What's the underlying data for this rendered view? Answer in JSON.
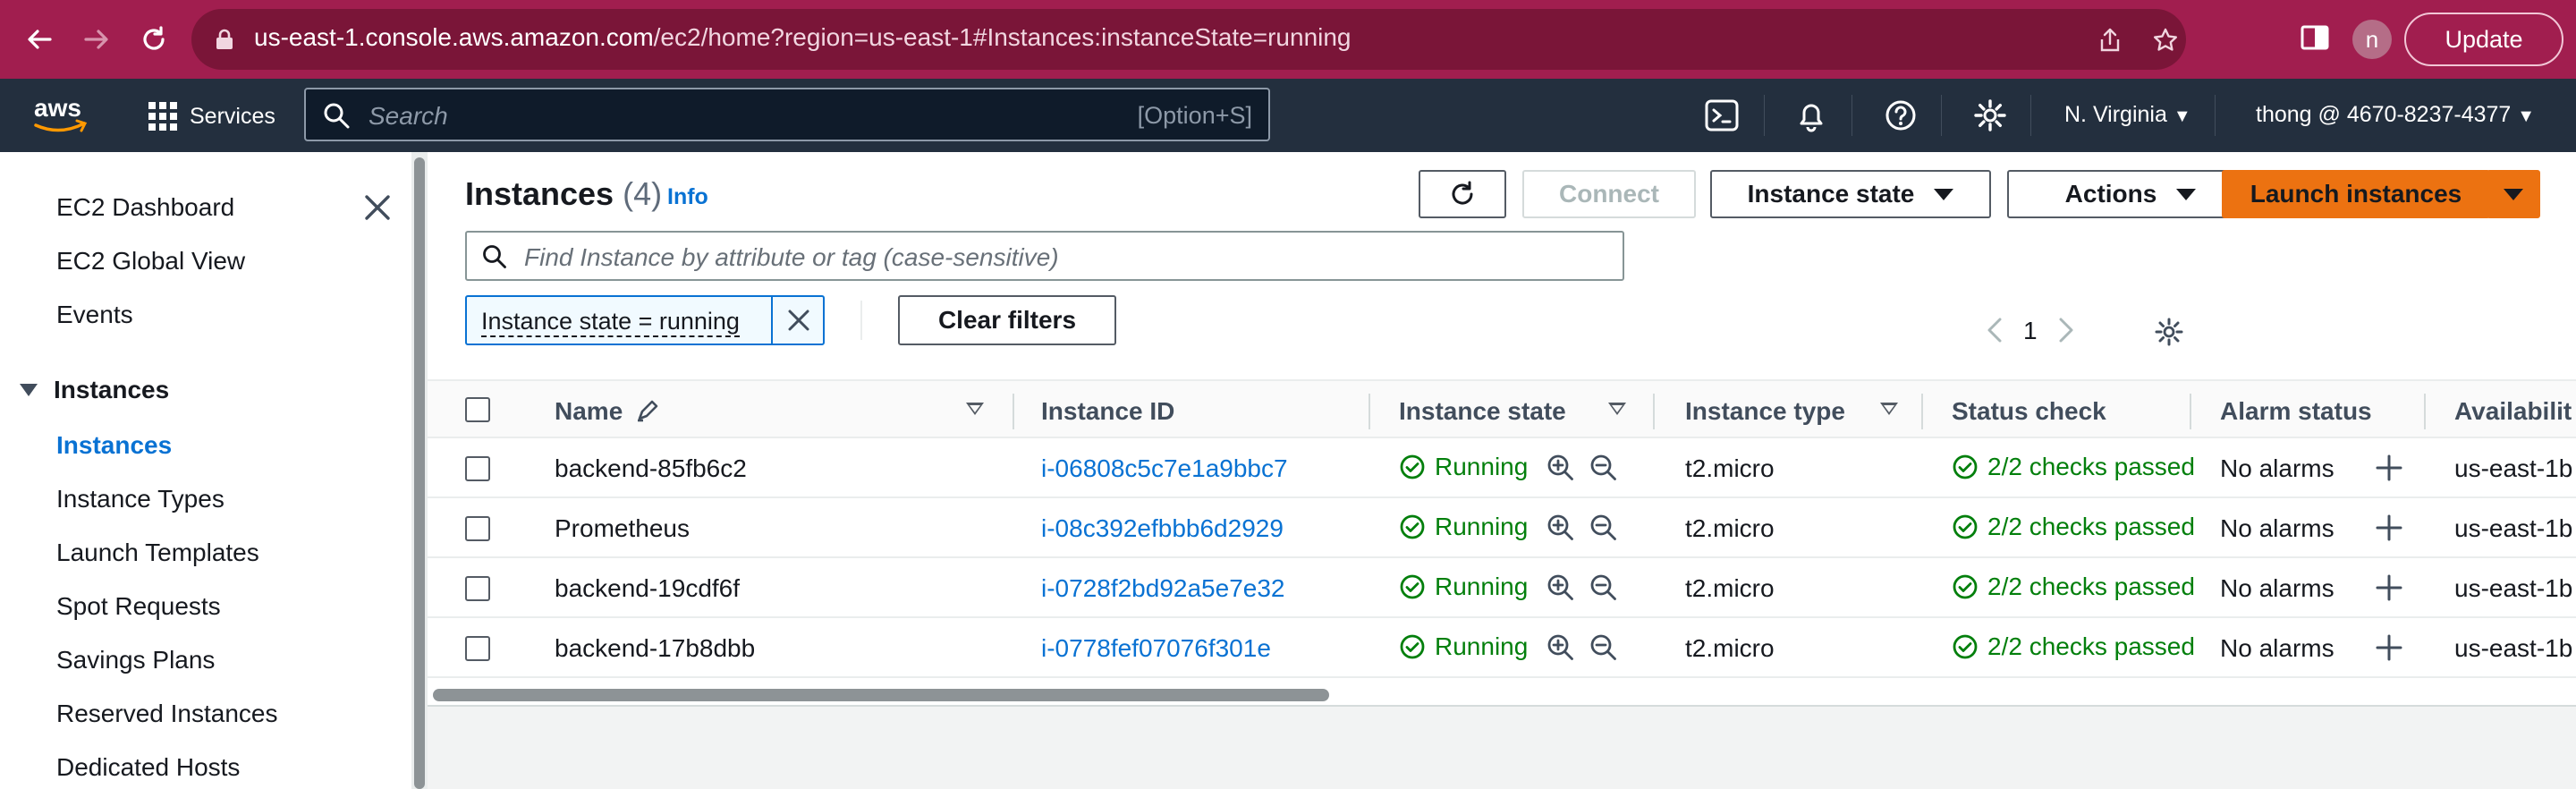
{
  "browser": {
    "url_host": "us-east-1.console.aws.amazon.com",
    "url_path": "/ec2/home?region=us-east-1#Instances:instanceState=running",
    "profile_initial": "n",
    "update_label": "Update"
  },
  "topnav": {
    "services_label": "Services",
    "search_placeholder": "Search",
    "search_shortcut": "[Option+S]",
    "region": "N. Virginia",
    "account": "thong @ 4670-8237-4377"
  },
  "sidebar": {
    "items": [
      {
        "label": "EC2 Dashboard"
      },
      {
        "label": "EC2 Global View"
      },
      {
        "label": "Events"
      }
    ],
    "group_label": "Instances",
    "group_items": [
      {
        "label": "Instances",
        "active": true
      },
      {
        "label": "Instance Types"
      },
      {
        "label": "Launch Templates"
      },
      {
        "label": "Spot Requests"
      },
      {
        "label": "Savings Plans"
      },
      {
        "label": "Reserved Instances"
      },
      {
        "label": "Dedicated Hosts"
      }
    ]
  },
  "header": {
    "title": "Instances",
    "count": "(4)",
    "info_label": "Info",
    "connect_label": "Connect",
    "instance_state_label": "Instance state",
    "actions_label": "Actions",
    "launch_label": "Launch instances"
  },
  "filter": {
    "placeholder": "Find Instance by attribute or tag (case-sensitive)",
    "token": "Instance state = running",
    "clear_label": "Clear filters",
    "page": "1"
  },
  "table": {
    "columns": [
      "Name",
      "Instance ID",
      "Instance state",
      "Instance type",
      "Status check",
      "Alarm status",
      "Availabilit"
    ],
    "rows": [
      {
        "name": "backend-85fb6c2",
        "id": "i-06808c5c7e1a9bbc7",
        "state": "Running",
        "type": "t2.micro",
        "status": "2/2 checks passed",
        "alarm": "No alarms",
        "az": "us-east-1b"
      },
      {
        "name": "Prometheus",
        "id": "i-08c392efbbb6d2929",
        "state": "Running",
        "type": "t2.micro",
        "status": "2/2 checks passed",
        "alarm": "No alarms",
        "az": "us-east-1b"
      },
      {
        "name": "backend-19cdf6f",
        "id": "i-0728f2bd92a5e7e32",
        "state": "Running",
        "type": "t2.micro",
        "status": "2/2 checks passed",
        "alarm": "No alarms",
        "az": "us-east-1b"
      },
      {
        "name": "backend-17b8dbb",
        "id": "i-0778fef07076f301e",
        "state": "Running",
        "type": "t2.micro",
        "status": "2/2 checks passed",
        "alarm": "No alarms",
        "az": "us-east-1b"
      }
    ]
  },
  "colors": {
    "chrome": "#a11e4f",
    "aws_nav": "#232f3e",
    "link": "#0972d3",
    "success": "#037f0c",
    "primary_button": "#ec7211"
  }
}
